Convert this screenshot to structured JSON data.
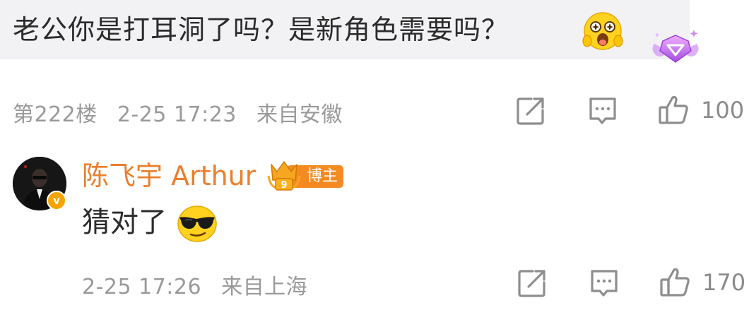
{
  "comment": {
    "text": "老公你是打耳洞了吗？是新角色需要吗？",
    "emoji_icon": "grinning-star-eyes-emoji",
    "badge_icon": "purple-diamond-badge-icon",
    "floor": "第222楼",
    "time": "2-25 17:23",
    "location": "来自安徽",
    "likes": "100"
  },
  "reply": {
    "name": "陈飞宇 Arthur",
    "badge_label": "博主",
    "badge_number": "9",
    "verified_mark": "v",
    "text": "猜对了",
    "emoji_icon": "cool-sunglasses-emoji",
    "time": "2-25 17:26",
    "location": "来自上海",
    "likes": "170"
  },
  "actions": {
    "share_icon": "share-icon",
    "comment_icon": "comment-icon",
    "like_icon": "thumbs-up-icon"
  },
  "colors": {
    "bubble_bg": "#f2f2f5",
    "meta_text": "#9a9a9a",
    "name_accent": "#eb7f2e",
    "badge_orange": "#f58a21",
    "verified_gold": "#f7a400"
  }
}
